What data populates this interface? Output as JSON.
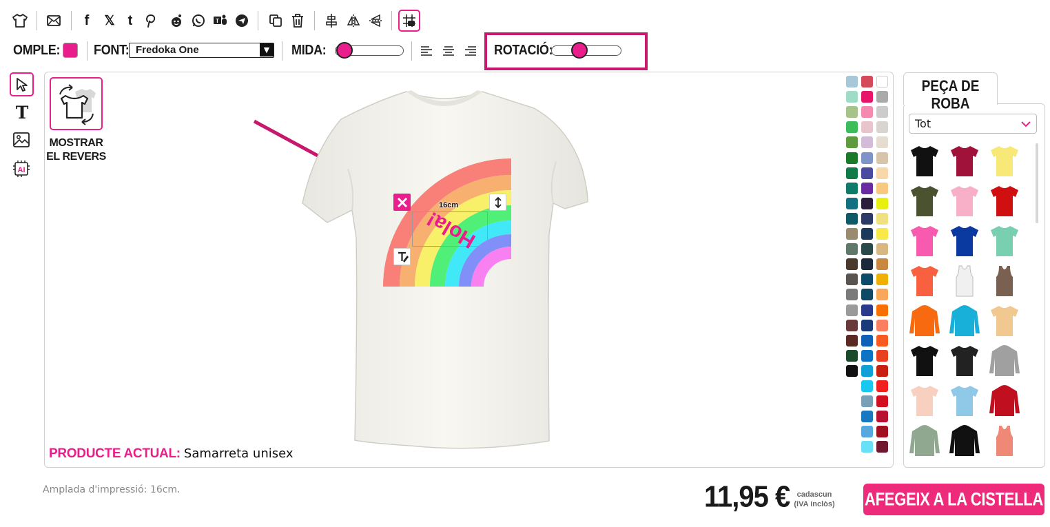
{
  "toolbar": {
    "icons": [
      "tshirt-icon",
      "email-icon",
      "facebook-icon",
      "x-icon",
      "tumblr-icon",
      "pinterest-icon",
      "reddit-icon",
      "whatsapp-icon",
      "teams-icon",
      "telegram-icon",
      "duplicate-icon",
      "delete-icon",
      "align-center-icon",
      "flip-horizontal-icon",
      "flip-vertical-icon",
      "grid-icon"
    ],
    "fill_label": "OMPLE:",
    "fill_color": "#e91e8c",
    "font_label": "FONT:",
    "font_value": "Fredoka One",
    "size_label": "MIDA:",
    "rotation_label": "ROTACIÓ:",
    "size_slider_value": 0.18,
    "rotation_slider_value": 0.42
  },
  "tools": [
    "select-icon",
    "text-icon",
    "image-icon",
    "ai-icon"
  ],
  "canvas": {
    "show_back_label_1": "MOSTRAR",
    "show_back_label_2": "EL REVERS",
    "dimension_label": "16cm",
    "design_text": "Hola!",
    "current_product_label": "PRODUCTE ACTUAL:",
    "current_product_value": "Samarreta unisex",
    "shirt_color": "#f6f5ef"
  },
  "colors_col1": [
    "#a8c8d8",
    "#9edcc8",
    "#a6c48a",
    "#3dbd5a",
    "#5e9a3e",
    "#1a7a2a",
    "#127a48",
    "#0e7a6a",
    "#127080",
    "#0e5a68",
    "#9a8a70",
    "#60786a",
    "#4a3a2e",
    "#5a5450",
    "#7a7a7a",
    "#9a9a9a",
    "#6a3a3a",
    "#5a2a22",
    "#1a4a2a",
    "#111111"
  ],
  "colors_col2": [
    "#d44a5a",
    "#e8146a",
    "#f48ab0",
    "#e8c4cc",
    "#d2bcd8",
    "#7e94c8",
    "#4a4aa0",
    "#6a2aa0",
    "#2a1e3a",
    "#2e3a66",
    "#1e3a5a",
    "#2a4a4a",
    "#1a2a3a",
    "#0e4a6a",
    "#0e4a66",
    "#2a3a8a",
    "#1a3a7a",
    "#1060b8",
    "#0c74c4",
    "#10a0d8",
    "#18c8f0",
    "#7aa0b8",
    "#1a78c0",
    "#58a8e0",
    "#68e0f8"
  ],
  "colors_col3": [
    "#ffffff",
    "#aaaaaa",
    "#cccccc",
    "#d8d4d0",
    "#e4ddd0",
    "#d8c4a8",
    "#f8d8a8",
    "#f8c880",
    "#e8f010",
    "#f0e080",
    "#f8e848",
    "#d8b880",
    "#c88840",
    "#f0b000",
    "#f8a858",
    "#f87000",
    "#f88060",
    "#f85a20",
    "#e84020",
    "#c82010",
    "#f02020",
    "#d01020",
    "#b81030",
    "#a01020",
    "#701830"
  ],
  "panel": {
    "tab_label": "PEÇA DE ROBA",
    "filter_value": "Tot",
    "garments": [
      {
        "name": "black-tshirt",
        "color": "#111111"
      },
      {
        "name": "burgundy-tshirt",
        "color": "#a0123a"
      },
      {
        "name": "yellow-tshirt",
        "color": "#f8e878"
      },
      {
        "name": "olive-tshirt",
        "color": "#4a5230"
      },
      {
        "name": "pink-womens-tshirt",
        "color": "#f8b0c8"
      },
      {
        "name": "red-tshirt",
        "color": "#d01010"
      },
      {
        "name": "hot-pink-womens-tshirt",
        "color": "#f85ab0"
      },
      {
        "name": "royal-blue-tshirt",
        "color": "#0a3aa0"
      },
      {
        "name": "mint-tshirt",
        "color": "#78d0b0"
      },
      {
        "name": "coral-womens-tshirt",
        "color": "#f86040"
      },
      {
        "name": "white-tank-top",
        "color": "#f0f0f0"
      },
      {
        "name": "brown-tank-top",
        "color": "#7a6050"
      },
      {
        "name": "orange-hoodie",
        "color": "#f86a10"
      },
      {
        "name": "turquoise-hoodie",
        "color": "#18b0d8"
      },
      {
        "name": "tie-dye-tshirt",
        "color": "#f0c890"
      },
      {
        "name": "black-tshirt-2",
        "color": "#111111"
      },
      {
        "name": "raglan-black-white",
        "color": "#222222"
      },
      {
        "name": "grey-hoodie",
        "color": "#a0a0a0"
      },
      {
        "name": "peach-tshirt",
        "color": "#f8d0c0"
      },
      {
        "name": "gradient-blue-tshirt",
        "color": "#90c8e8"
      },
      {
        "name": "red-varsity-jacket",
        "color": "#c01020"
      },
      {
        "name": "sage-longsleeve",
        "color": "#90a890"
      },
      {
        "name": "black-orange-hoodie",
        "color": "#111111"
      },
      {
        "name": "salmon-tank-top",
        "color": "#f08878"
      }
    ]
  },
  "footer": {
    "print_width": "Amplada d'impressió: 16cm.",
    "price": "11,95 €",
    "price_note_1": "cadascun",
    "price_note_2": "(IVA inclòs)",
    "add_to_cart": "AFEGEIX A LA CISTELLA"
  },
  "accent_color": "#e91e8c"
}
